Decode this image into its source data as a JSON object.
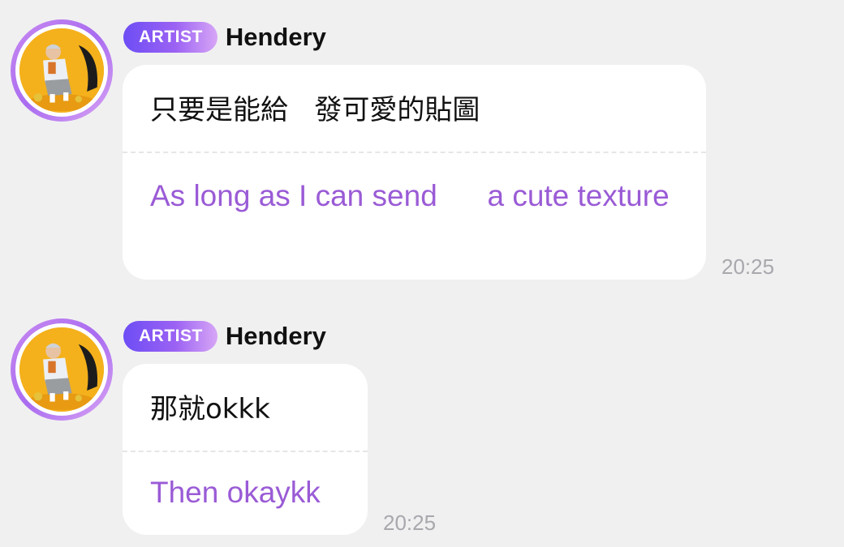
{
  "messages": [
    {
      "badge": "ARTIST",
      "sender": "Hendery",
      "original": "只要是能給   發可愛的貼圖",
      "translation": "As long as I can send      a cute texture",
      "time": "20:25",
      "avatar": "artist-profile-photo"
    },
    {
      "badge": "ARTIST",
      "sender": "Hendery",
      "original": "那就okkk",
      "translation": "Then okaykk",
      "time": "20:25",
      "avatar": "artist-profile-photo"
    }
  ],
  "colors": {
    "background": "#f0f0f1",
    "bubble": "#ffffff",
    "translation_text": "#9a5bd6",
    "badge_start": "#6d4df5",
    "badge_end": "#d7a6f6",
    "timestamp": "#a8a8ad"
  }
}
